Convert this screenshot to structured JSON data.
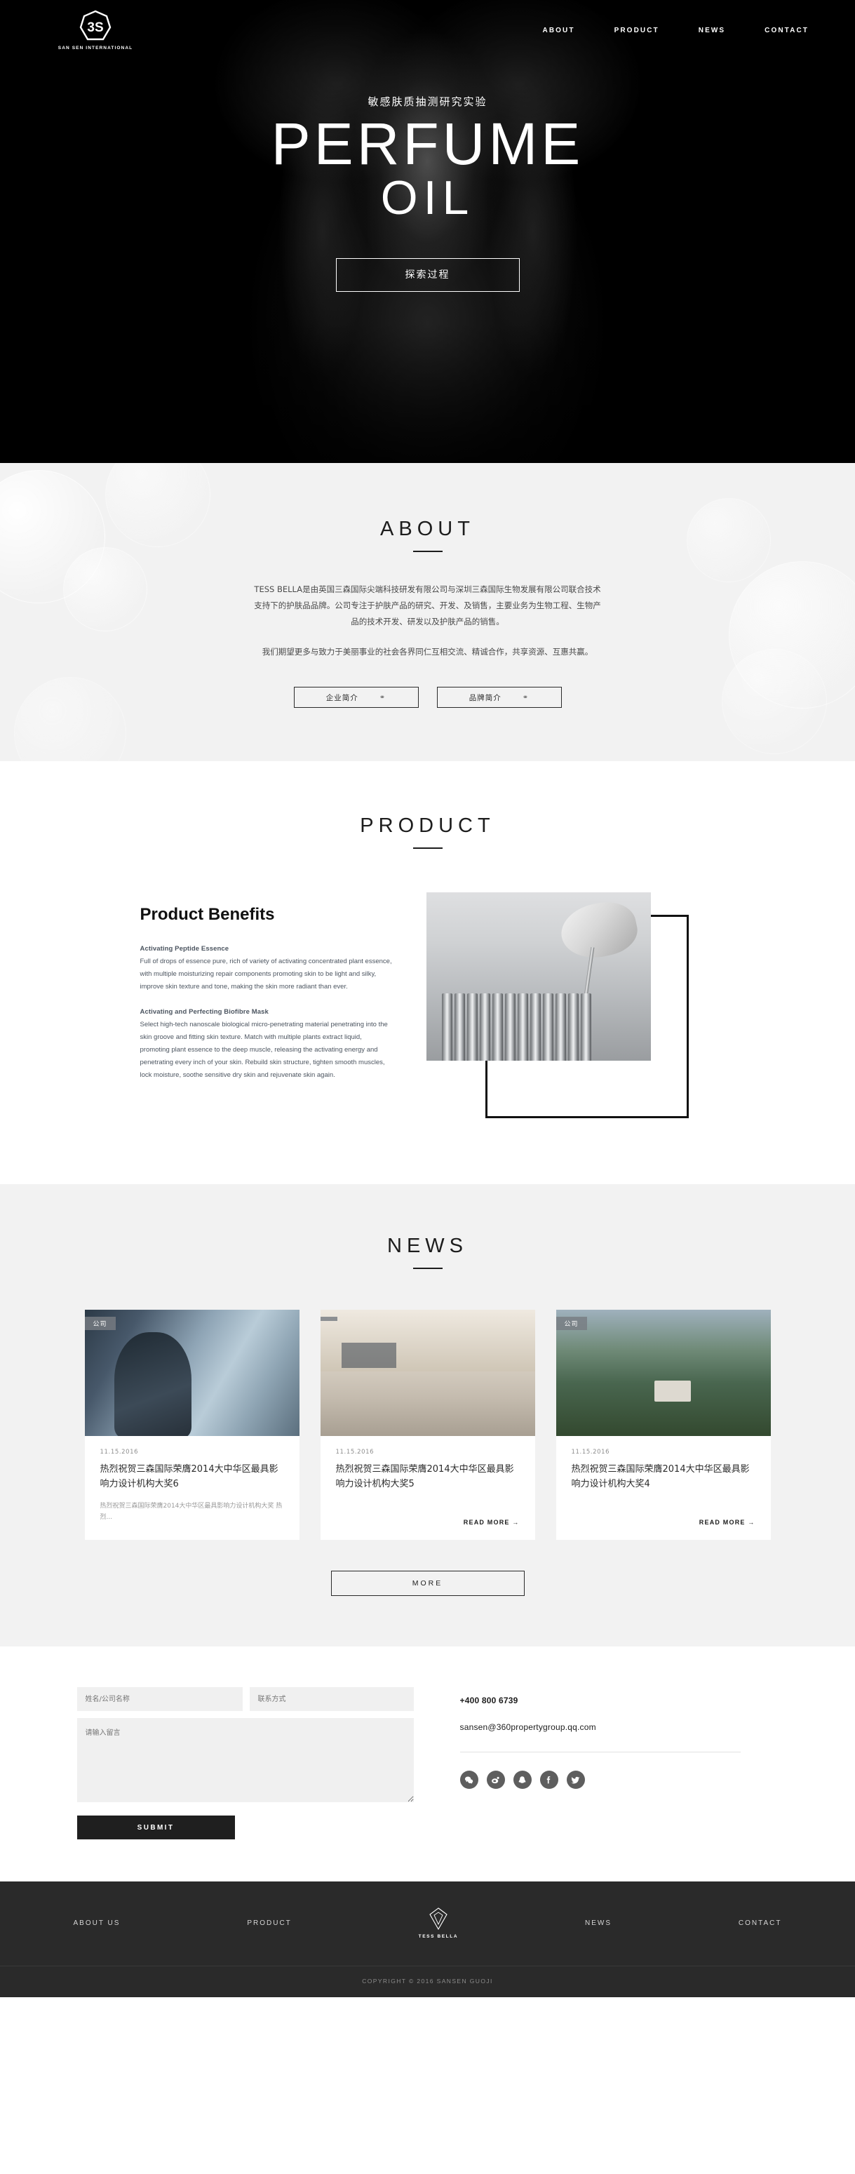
{
  "brand": {
    "mark": "3S",
    "name": "SAN SEN INTERNATIONAL",
    "footer_name": "TESS BELLA"
  },
  "nav": {
    "items": [
      {
        "label": "ABOUT"
      },
      {
        "label": "PRODUCT"
      },
      {
        "label": "NEWS"
      },
      {
        "label": "CONTACT"
      }
    ]
  },
  "hero": {
    "subtitle": "敏感肤质抽测研究实验",
    "title_line1": "PERFUME",
    "title_line2": "OIL",
    "cta": "探索过程"
  },
  "about": {
    "title": "ABOUT",
    "paragraph1": "TESS BELLA是由英国三森国际尖端科技研发有限公司与深圳三森国际生物发展有限公司联合技术支持下的护肤品品牌。公司专注于护肤产品的研究、开发、及销售，主要业务为生物工程、生物产品的技术开发、研发以及护肤产品的销售。",
    "paragraph2": "我们期望更多与致力于美丽事业的社会各界同仁互相交流、精诚合作，共享资源、互惠共赢。",
    "buttons": [
      {
        "label": "企业简介",
        "icon": "link-icon"
      },
      {
        "label": "品牌简介",
        "icon": "link-icon"
      }
    ]
  },
  "product": {
    "title": "PRODUCT",
    "heading": "Product Benefits",
    "blocks": [
      {
        "heading": "Activating Peptide Essence",
        "body": "Full of drops of essence pure, rich of variety of activating concentrated plant essence, with multiple moisturizing repair components promoting skin to be light and silky, improve skin texture and tone, making the skin more radiant than ever."
      },
      {
        "heading": "Activating and Perfecting Biofibre Mask",
        "body": "Select high-tech nanoscale biological micro-penetrating material penetrating into the skin groove and fitting skin texture. Match with multiple plants extract liquid, promoting plant essence to the deep muscle, releasing the activating energy and penetrating every inch of your skin. Rebuild skin structure, tighten smooth muscles, lock moisture, soothe sensitive dry skin and rejuvenate skin again."
      }
    ]
  },
  "news": {
    "title": "NEWS",
    "more_button": "MORE",
    "cards": [
      {
        "badge": "公司",
        "date": "11.15.2016",
        "title": "热烈祝贺三森国际荣膺2014大中华区最具影响力设计机构大奖6",
        "excerpt": "热烈祝贺三森国际荣膺2014大中华区最具影响力设计机构大奖 热烈...",
        "read_more": ""
      },
      {
        "badge": "",
        "date": "11.15.2016",
        "title": "热烈祝贺三森国际荣膺2014大中华区最具影响力设计机构大奖5",
        "excerpt": "",
        "read_more": "READ MORE →"
      },
      {
        "badge": "公司",
        "date": "11.15.2016",
        "title": "热烈祝贺三森国际荣膺2014大中华区最具影响力设计机构大奖4",
        "excerpt": "",
        "read_more": "READ MORE →"
      }
    ]
  },
  "contact": {
    "name_placeholder": "姓名/公司名称",
    "contact_placeholder": "联系方式",
    "message_placeholder": "请输入留言",
    "submit_label": "SUBMIT",
    "phone": "+400 800 6739",
    "email": "sansen@360propertygroup.qq.com",
    "socials": [
      {
        "name": "wechat-icon"
      },
      {
        "name": "weibo-icon"
      },
      {
        "name": "qq-icon"
      },
      {
        "name": "facebook-icon"
      },
      {
        "name": "twitter-icon"
      }
    ]
  },
  "footer": {
    "links": [
      {
        "label": "ABOUT US"
      },
      {
        "label": "PRODUCT"
      },
      {
        "label": "NEWS"
      },
      {
        "label": "CONTACT"
      }
    ],
    "copyright": "COPYRIGHT © 2016 SANSEN GUOJI"
  },
  "colors": {
    "dark": "#1d1d1d",
    "footer_bg": "#2a2a2a",
    "section_grey": "#f2f2f2",
    "field_grey": "#f0f0f0"
  }
}
